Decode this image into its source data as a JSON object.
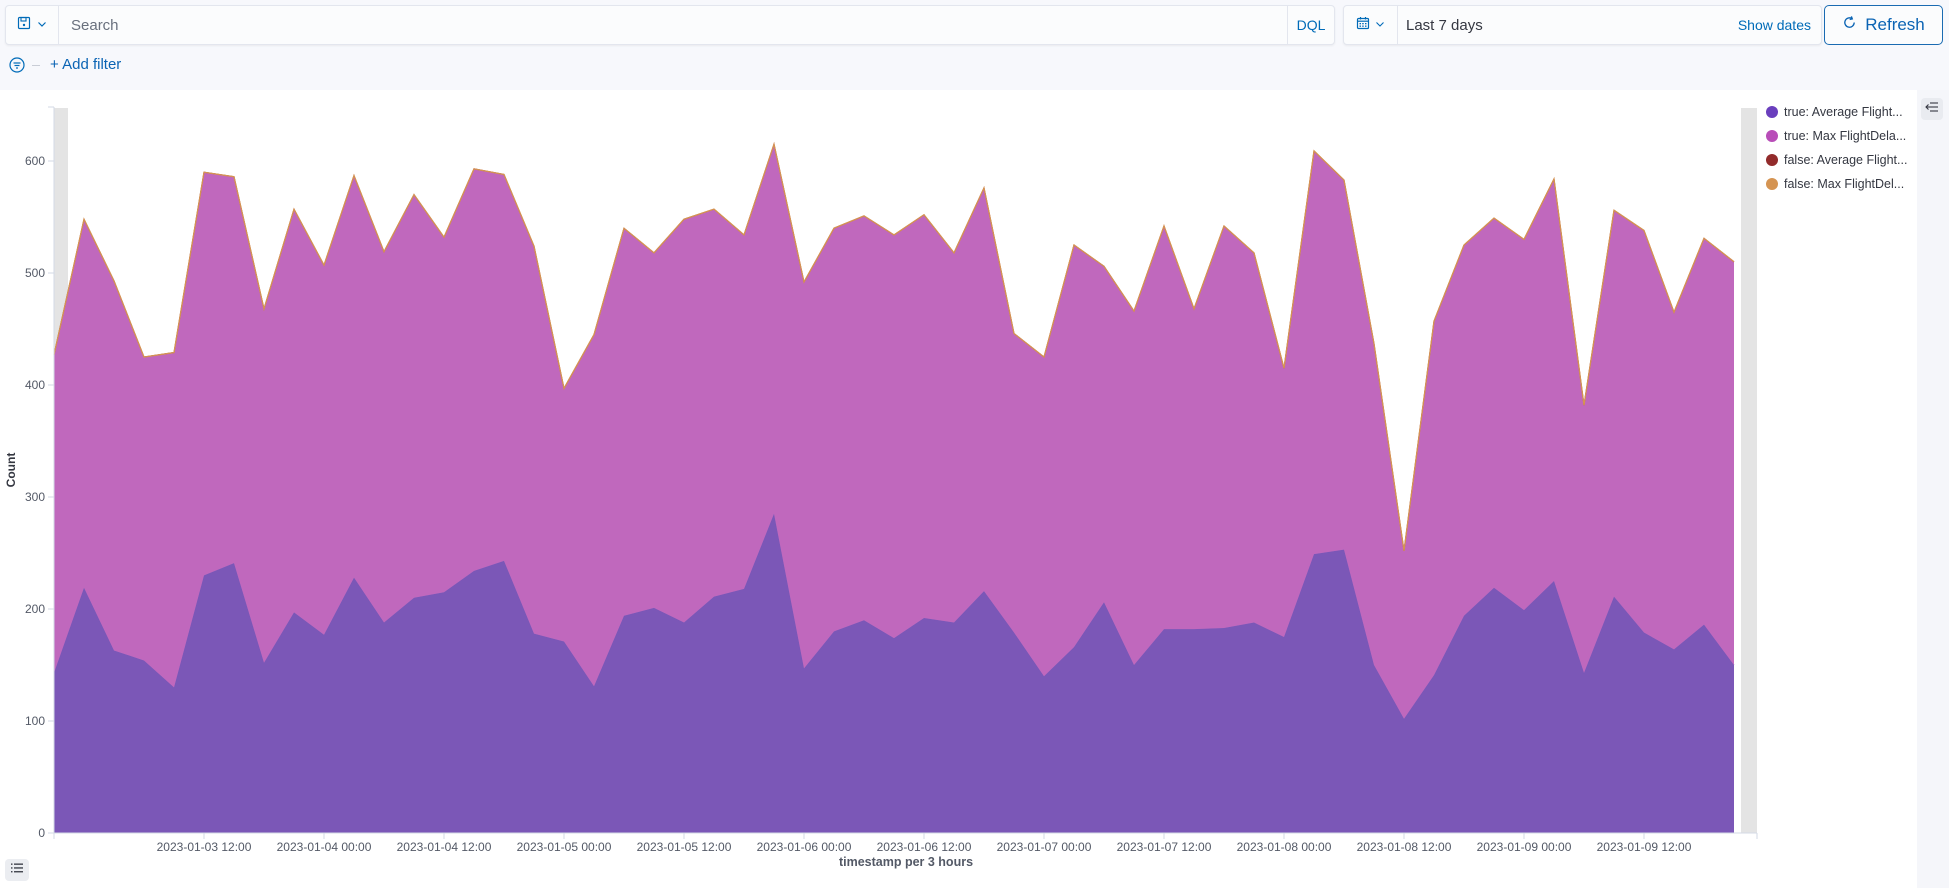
{
  "query_bar": {
    "search_placeholder": "Search",
    "search_value": "",
    "language_label": "DQL",
    "saved_query_icon": "save-icon",
    "chevron_icon": "chevron-down-icon"
  },
  "date_picker": {
    "calendar_icon": "calendar-icon",
    "range_label": "Last 7 days",
    "show_dates_label": "Show dates",
    "refresh_label": "Refresh",
    "refresh_icon": "refresh-icon"
  },
  "filter_bar": {
    "filter_icon": "filter-icon",
    "add_filter_label": "+ Add filter"
  },
  "legend": {
    "toggle_icon": "legend-collapse-icon",
    "items": [
      {
        "label": "true: Average Flight...",
        "color": "#6a3fbd"
      },
      {
        "label": "true: Max FlightDela...",
        "color": "#b84db8"
      },
      {
        "label": "false: Average Flight...",
        "color": "#922b2b"
      },
      {
        "label": "false: Max FlightDel...",
        "color": "#d59452"
      }
    ]
  },
  "bottom_toolbar": {
    "list_icon": "list-icon"
  },
  "chart_data": {
    "type": "area",
    "stacked": true,
    "title": "",
    "xlabel": "timestamp per 3 hours",
    "ylabel": "Count",
    "ylim": [
      0,
      650
    ],
    "y_ticks": [
      0,
      100,
      200,
      300,
      400,
      500,
      600
    ],
    "x_start": "2023-01-02 21:00",
    "x_interval_hours": 3,
    "x_ticks": [
      "2023-01-03 12:00",
      "2023-01-04 00:00",
      "2023-01-04 12:00",
      "2023-01-05 00:00",
      "2023-01-05 12:00",
      "2023-01-06 00:00",
      "2023-01-06 12:00",
      "2023-01-07 00:00",
      "2023-01-07 12:00",
      "2023-01-08 00:00",
      "2023-01-08 12:00",
      "2023-01-09 00:00",
      "2023-01-09 12:00"
    ],
    "x_tick_index": [
      5,
      9,
      13,
      17,
      21,
      25,
      29,
      33,
      37,
      41,
      45,
      49,
      53
    ],
    "grid": false,
    "legend_position": "right",
    "series": [
      {
        "name": "true: Average FlightDelayMin",
        "color": "#7b57b7",
        "values": [
          143,
          219,
          163,
          154,
          130,
          230,
          241,
          152,
          197,
          177,
          228,
          188,
          210,
          215,
          234,
          243,
          178,
          171,
          131,
          194,
          201,
          188,
          211,
          218,
          285,
          147,
          180,
          190,
          174,
          192,
          188,
          216,
          179,
          140,
          166,
          206,
          150,
          182,
          182,
          183,
          188,
          175,
          249,
          253,
          150,
          102,
          141,
          194,
          219,
          199,
          225,
          143,
          211,
          179,
          164,
          186,
          150
        ]
      },
      {
        "name": "true: Max FlightDelayMin",
        "color": "#c068bd",
        "values": [
          284,
          329,
          330,
          271,
          299,
          360,
          345,
          316,
          360,
          330,
          359,
          331,
          360,
          317,
          359,
          345,
          346,
          226,
          314,
          346,
          317,
          360,
          346,
          316,
          330,
          345,
          360,
          361,
          360,
          360,
          330,
          360,
          267,
          285,
          359,
          300,
          316,
          360,
          286,
          359,
          330,
          240,
          360,
          330,
          287,
          150,
          316,
          331,
          330,
          331,
          359,
          239,
          345,
          359,
          301,
          345,
          360
        ]
      },
      {
        "name": "false: Average FlightDelayMin",
        "color": "#922b2b",
        "values": [
          0,
          0,
          0,
          0,
          0,
          0,
          0,
          0,
          0,
          0,
          0,
          0,
          0,
          0,
          0,
          0,
          0,
          0,
          0,
          0,
          0,
          0,
          0,
          0,
          0,
          0,
          0,
          0,
          0,
          0,
          0,
          0,
          0,
          0,
          0,
          0,
          0,
          0,
          0,
          0,
          0,
          0,
          0,
          0,
          0,
          0,
          0,
          0,
          0,
          0,
          0,
          0,
          0,
          0,
          0,
          0,
          0
        ]
      },
      {
        "name": "false: Max FlightDelayMin",
        "color": "#d59452",
        "values": [
          0,
          0,
          0,
          0,
          0,
          0,
          0,
          0,
          0,
          0,
          0,
          0,
          0,
          0,
          0,
          0,
          0,
          0,
          0,
          0,
          0,
          0,
          0,
          0,
          0,
          0,
          0,
          0,
          0,
          0,
          0,
          0,
          0,
          0,
          0,
          0,
          0,
          0,
          0,
          0,
          0,
          0,
          0,
          0,
          0,
          0,
          0,
          0,
          0,
          0,
          0,
          0,
          0,
          0,
          0,
          0,
          0
        ]
      }
    ]
  }
}
